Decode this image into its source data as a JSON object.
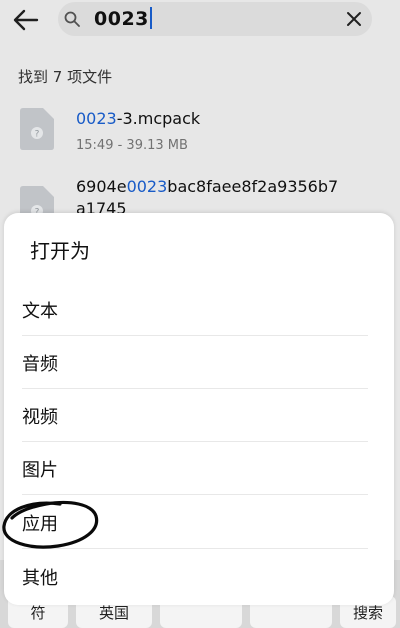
{
  "search": {
    "query": "0023"
  },
  "results": {
    "summary": "找到 7 项文件",
    "files": [
      {
        "name_highlight": "0023",
        "name_rest": "-3.mcpack",
        "meta": "15:49 - 39.13 MB"
      },
      {
        "name_prefix": "6904e",
        "name_highlight": "0023",
        "name_rest": "bac8faee8f2a9356b7",
        "name_line2": "a1745"
      }
    ]
  },
  "open_with": {
    "title": "打开为",
    "options": [
      "文本",
      "音频",
      "视频",
      "图片",
      "应用",
      "其他"
    ]
  },
  "keyboard": {
    "keys": [
      "符",
      "英国",
      "",
      "",
      "搜索"
    ]
  },
  "colors": {
    "highlight": "#1a5fd0",
    "background": "#f1f1f1",
    "sheet": "#ffffff"
  },
  "icons": {
    "back": "arrow-left-icon",
    "search": "search-icon",
    "clear": "close-icon",
    "file": "unknown-file-icon"
  }
}
